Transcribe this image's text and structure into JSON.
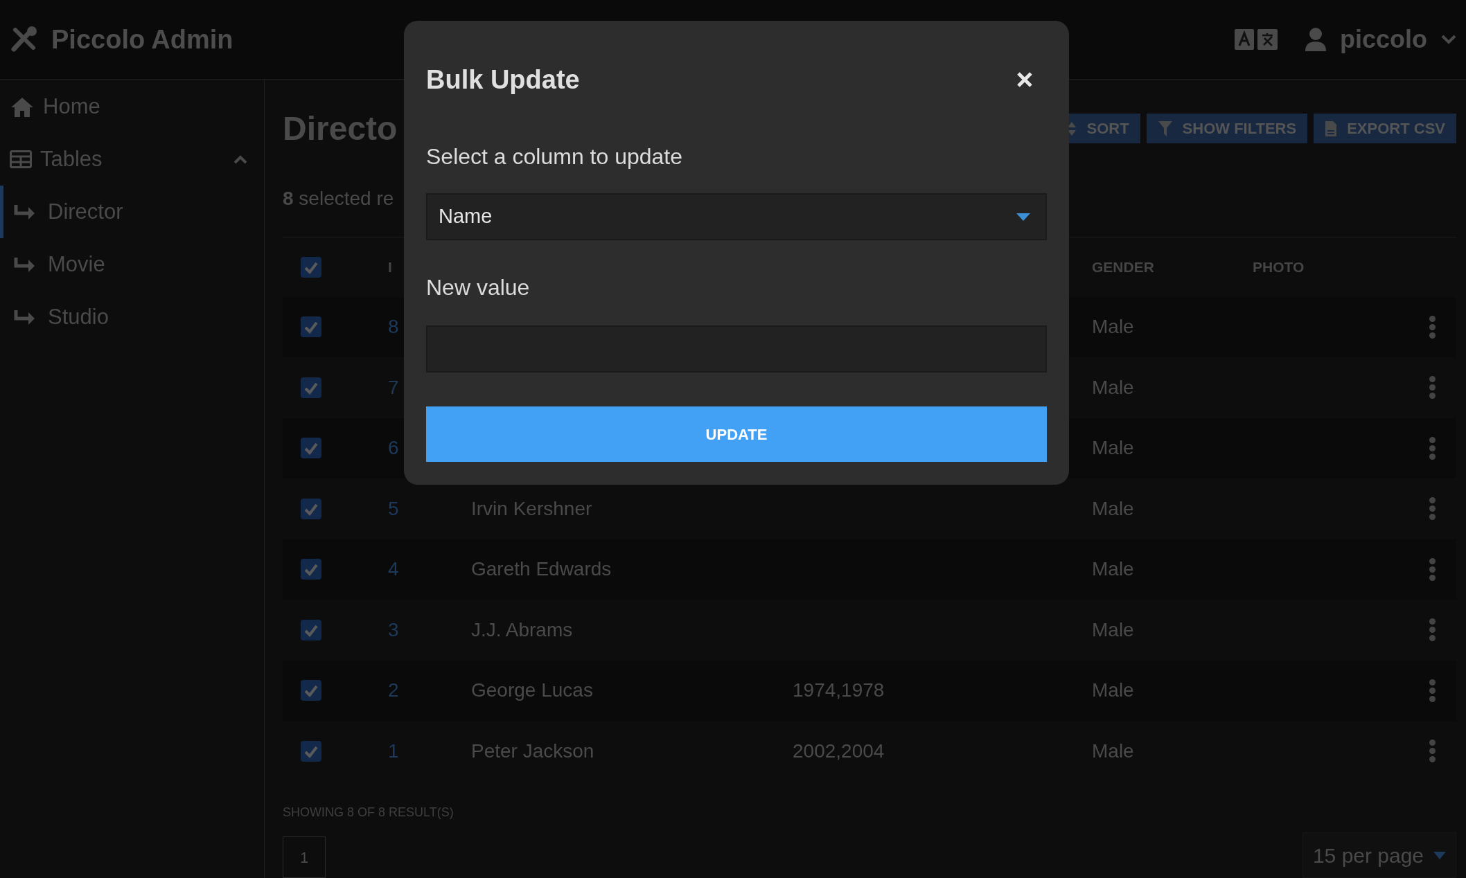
{
  "app": {
    "title": "Piccolo Admin",
    "user": "piccolo"
  },
  "sidebar": {
    "items": [
      {
        "kind": "link",
        "label": "Home",
        "selected": false
      },
      {
        "kind": "group",
        "label": "Tables",
        "selected": false,
        "expanded": true,
        "children": [
          {
            "label": "Director",
            "selected": true
          },
          {
            "label": "Movie",
            "selected": false
          },
          {
            "label": "Studio",
            "selected": false
          }
        ]
      }
    ]
  },
  "page": {
    "title": "Directo",
    "selection_note": "**8** selected re",
    "toolbar": [
      {
        "kind": "sort",
        "label": "SORT"
      },
      {
        "kind": "filter",
        "label": "SHOW FILTERS"
      },
      {
        "kind": "csv",
        "label": "EXPORT CSV"
      }
    ]
  },
  "table": {
    "all_checked": true,
    "columns": {
      "id": "I",
      "gender": "GENDER",
      "photo": "PHOTO"
    },
    "rows": [
      {
        "checked": true,
        "id": "8",
        "gender": "Male"
      },
      {
        "checked": true,
        "id": "7",
        "gender": "Male"
      },
      {
        "checked": true,
        "id": "6",
        "gender": "Male"
      },
      {
        "checked": true,
        "id": "5",
        "name": "Irvin Kershner",
        "gender": "Male"
      },
      {
        "checked": true,
        "id": "4",
        "name": "Gareth Edwards",
        "gender": "Male"
      },
      {
        "checked": true,
        "id": "3",
        "name": "J.J. Abrams",
        "gender": "Male"
      },
      {
        "checked": true,
        "id": "2",
        "name": "George Lucas",
        "column_4": "1974,1978",
        "gender": "Male"
      },
      {
        "checked": true,
        "id": "1",
        "name": "Peter Jackson",
        "column_4": "2002,2004",
        "gender": "Male"
      }
    ]
  },
  "footer": {
    "summary": "SHOWING 8 OF 8 RESULT(S)",
    "pages": [
      "1"
    ],
    "per_page": "15 per page"
  },
  "modal": {
    "title": "Bulk Update",
    "column_label": "Select a column to update",
    "column_value": "Name",
    "value_label": "New value",
    "button": "UPDATE"
  }
}
